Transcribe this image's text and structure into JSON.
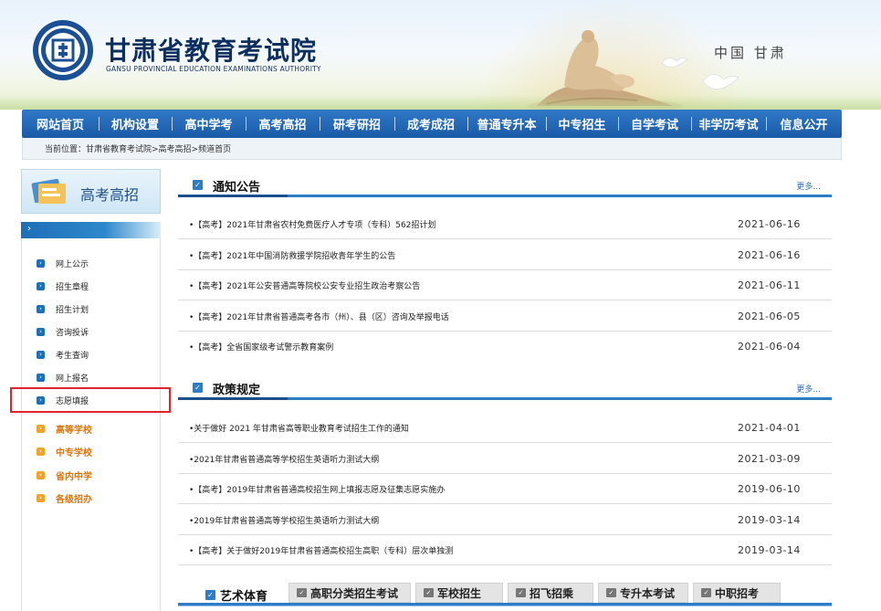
{
  "header": {
    "title": "甘肃省教育考试院",
    "subtitle": "GANSU PROVINCIAL EDUCATION EXAMINATIONS AUTHORITY",
    "region": "中国 甘肃",
    "seal_text": "甘肃省教育考试院"
  },
  "nav": [
    {
      "label": "网站首页"
    },
    {
      "label": "机构设置"
    },
    {
      "label": "高中学考"
    },
    {
      "label": "高考高招"
    },
    {
      "label": "研考研招"
    },
    {
      "label": "成考成招"
    },
    {
      "label": "普通专升本"
    },
    {
      "label": "中专招生"
    },
    {
      "label": "自学考试"
    },
    {
      "label": "非学历考试"
    },
    {
      "label": "信息公开"
    }
  ],
  "breadcrumb": "当前位置：甘肃省教育考试院>高考高招>频道首页",
  "sidebar": {
    "title": "高考高招",
    "bar_arrow": "›",
    "items": [
      {
        "label": "网上公示"
      },
      {
        "label": "招生章程"
      },
      {
        "label": "招生计划"
      },
      {
        "label": "咨询投诉"
      },
      {
        "label": "考生查询"
      },
      {
        "label": "网上报名"
      },
      {
        "label": "志愿填报"
      }
    ],
    "orange_items": [
      {
        "label": "高等学校"
      },
      {
        "label": "中专学校"
      },
      {
        "label": "省内中学"
      },
      {
        "label": "各级招办"
      }
    ]
  },
  "notice": {
    "title": "通知公告",
    "more": "更多...",
    "rows": [
      {
        "text": "•【高考】2021年甘肃省农村免费医疗人才专项（专科）562招计划",
        "date": "2021-06-16"
      },
      {
        "text": "•【高考】2021年中国消防救援学院招收青年学生的公告",
        "date": "2021-06-16"
      },
      {
        "text": "•【高考】2021年公安普通高等院校公安专业招生政治考察公告",
        "date": "2021-06-11"
      },
      {
        "text": "•【高考】2021年甘肃省普通高考各市（州）、县（区）咨询及举报电话",
        "date": "2021-06-05"
      },
      {
        "text": "•【高考】全省国家级考试警示教育案例",
        "date": "2021-06-04"
      }
    ]
  },
  "policy": {
    "title": "政策规定",
    "more": "更多...",
    "rows": [
      {
        "text": "•关于做好 2021 年甘肃省高等职业教育考试招生工作的通知",
        "date": "2021-04-01"
      },
      {
        "text": "•2021年甘肃省普通高等学校招生英语听力测试大纲",
        "date": "2021-03-09"
      },
      {
        "text": "•【高考】2019年甘肃省普通高校招生网上填报志愿及征集志愿实施办",
        "date": "2019-06-10"
      },
      {
        "text": "•2019年甘肃省普通高等学校招生英语听力测试大纲",
        "date": "2019-03-14"
      },
      {
        "text": "•【高考】关于做好2019年甘肃省普通高校招生高职（专科）层次单独测",
        "date": "2019-03-14"
      }
    ]
  },
  "bottom_tabs": {
    "first": "艺术体育",
    "tabs": [
      {
        "label": "高职分类招生考试"
      },
      {
        "label": "军校招生"
      },
      {
        "label": "招飞招乘"
      },
      {
        "label": "专升本考试"
      },
      {
        "label": "中职招考"
      }
    ]
  },
  "colors": {
    "nav_blue": "#1a5aa7",
    "accent_blue": "#2d7cc8",
    "sidebar_orange": "#d9750b",
    "highlight_red": "#e0242b"
  }
}
